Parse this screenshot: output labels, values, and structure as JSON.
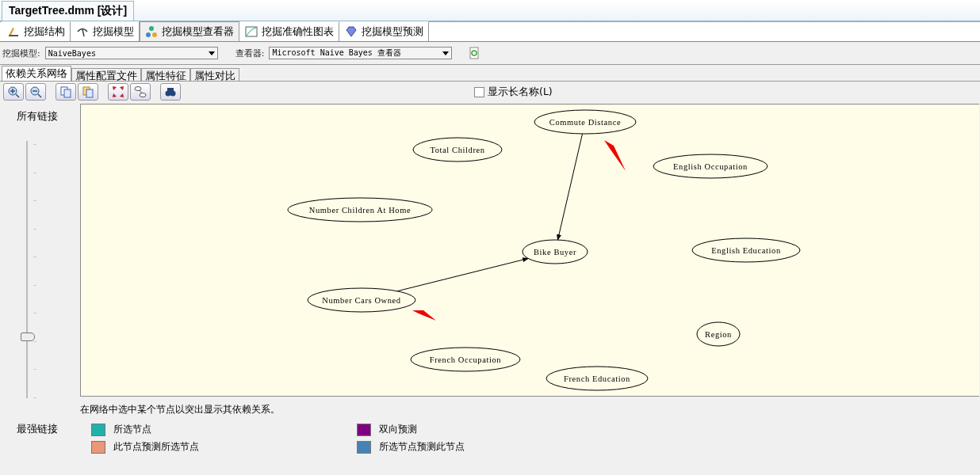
{
  "document_tab": {
    "title": "TargetTree.dmm [设计]"
  },
  "main_tabs": [
    {
      "label": "挖掘结构",
      "selected": false
    },
    {
      "label": "挖掘模型",
      "selected": false
    },
    {
      "label": "挖掘模型查看器",
      "selected": true
    },
    {
      "label": "挖掘准确性图表",
      "selected": false
    },
    {
      "label": "挖掘模型预测",
      "selected": false
    }
  ],
  "model_select": {
    "label": "挖掘模型:",
    "value": "NaiveBayes"
  },
  "viewer_select": {
    "label": "查看器:",
    "value": "Microsoft Naive Bayes 查看器"
  },
  "sub_tabs": [
    {
      "label": "依赖关系网络",
      "selected": true
    },
    {
      "label": "属性配置文件",
      "selected": false
    },
    {
      "label": "属性特征",
      "selected": false
    },
    {
      "label": "属性对比",
      "selected": false
    }
  ],
  "long_names": {
    "label": "显示长名称(L)",
    "checked": false
  },
  "slider": {
    "top_label": "所有链接",
    "bottom_label": "最强链接",
    "level": 0.23
  },
  "nodes": [
    {
      "label": "Commute Distance"
    },
    {
      "label": "Total Children"
    },
    {
      "label": "English Occupation"
    },
    {
      "label": "Number Children At Home"
    },
    {
      "label": "Bike Buyer"
    },
    {
      "label": "English Education"
    },
    {
      "label": "Number Cars Owned"
    },
    {
      "label": "Region"
    },
    {
      "label": "French Occupation"
    },
    {
      "label": "French Education"
    }
  ],
  "hint": "在网络中选中某个节点以突出显示其依赖关系。",
  "legend": [
    {
      "label": "所选节点",
      "color": "#20b2aa"
    },
    {
      "label": "双向预测",
      "color": "#800080"
    },
    {
      "label": "此节点预测所选节点",
      "color": "#e9967a"
    },
    {
      "label": "所选节点预测此节点",
      "color": "#4682b4"
    }
  ]
}
